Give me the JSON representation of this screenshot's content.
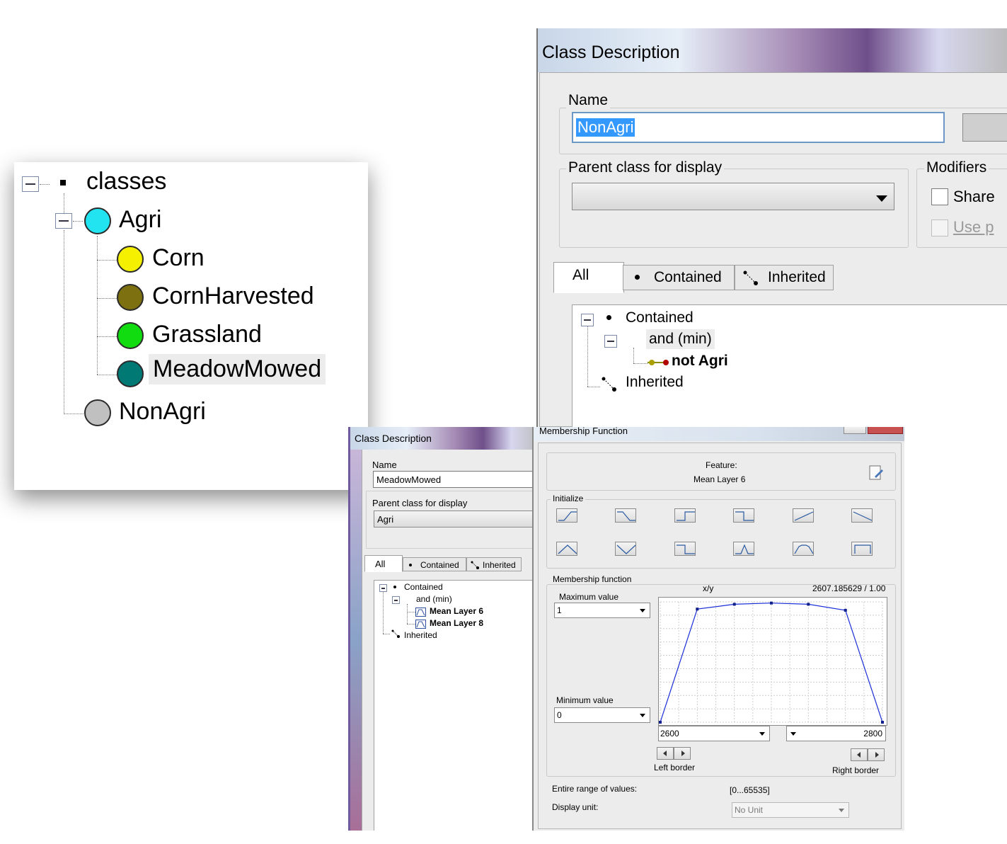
{
  "class_tree": {
    "root_label": "classes",
    "agri": "Agri",
    "children": [
      "Corn",
      "CornHarvested",
      "Grassland",
      "MeadowMowed"
    ],
    "nonagri": "NonAgri",
    "colors": {
      "agri": "#22e4f0",
      "corn": "#f4f000",
      "cornharvested": "#7c7010",
      "grassland": "#10dc10",
      "meadowmowed": "#007874",
      "nonagri": "#c0c0c0"
    }
  },
  "dialog_large": {
    "title": "Class Description",
    "name_label": "Name",
    "name_value": "NonAgri",
    "parent_label": "Parent class for display",
    "parent_value": "",
    "modifiers_label": "Modifiers",
    "shared_label": "Share",
    "use_label": "Use p",
    "tabs": [
      "All",
      "Contained",
      "Inherited"
    ],
    "tree": {
      "contained": "Contained",
      "and": "and (min)",
      "not": "not Agri",
      "inherited": "Inherited"
    }
  },
  "dialog_small": {
    "title": "Class Description",
    "name_label": "Name",
    "name_value": "MeadowMowed",
    "parent_label": "Parent class for display",
    "parent_value": "Agri",
    "tabs": [
      "All",
      "Contained",
      "Inherited"
    ],
    "tree": {
      "contained": "Contained",
      "and": "and (min)",
      "item1": "Mean Layer 6",
      "item2": "Mean Layer 8",
      "inherited": "Inherited"
    }
  },
  "membership": {
    "title": "Membership Function",
    "feature_label": "Feature:",
    "feature_value": "Mean Layer 6",
    "initialize_label": "Initialize",
    "mf_label": "Membership function",
    "max_label": "Maximum value",
    "max_value": "1",
    "min_label": "Minimum value",
    "min_value": "0",
    "xy_label": "x/y",
    "xy_value": "2607.185629 / 1.00",
    "left_value": "2600",
    "right_value": "2800",
    "left_border": "Left border",
    "right_border": "Right border",
    "range_label": "Entire range of values:",
    "range_value": "[0...65535]",
    "unit_label": "Display unit:",
    "unit_value": "No Unit"
  },
  "chart_data": {
    "type": "line",
    "xlim": [
      2600,
      2800
    ],
    "ylim": [
      0,
      1
    ],
    "x": [
      2600,
      2633.3,
      2666.7,
      2700,
      2733.3,
      2766.7,
      2800
    ],
    "y": [
      0,
      0.94,
      0.98,
      0.99,
      0.98,
      0.93,
      0
    ],
    "grid": true
  }
}
